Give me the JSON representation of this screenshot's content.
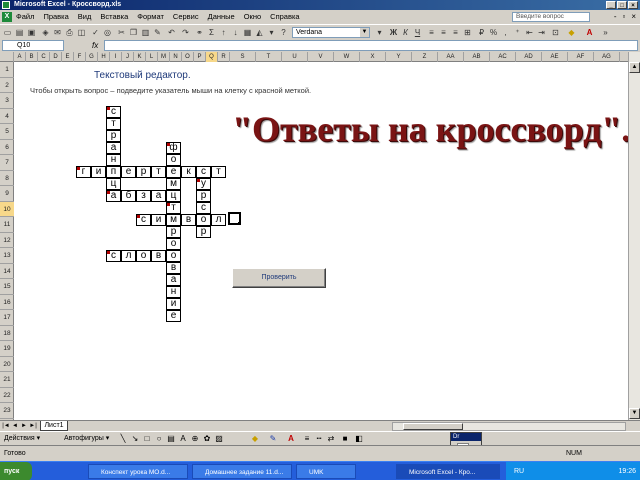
{
  "window": {
    "title": "Microsoft Excel - Кроссворд.xls",
    "buttons": [
      "_",
      "□",
      "×"
    ]
  },
  "menu": {
    "items": [
      "Файл",
      "Правка",
      "Вид",
      "Вставка",
      "Формат",
      "Сервис",
      "Данные",
      "Окно",
      "Справка"
    ],
    "help_placeholder": "Введите вопрос",
    "doc_controls": [
      "-",
      "▫",
      "×"
    ]
  },
  "toolbar": {
    "font_name": "Verdana",
    "icon_names": [
      "new-icon",
      "open-icon",
      "save-icon",
      "permission-icon",
      "email-icon",
      "print-icon",
      "preview-icon",
      "spelling-icon",
      "research-icon",
      "cut-icon",
      "copy-icon",
      "paste-icon",
      "format-painter-icon",
      "undo-icon",
      "redo-icon",
      "hyperlink-icon",
      "autosum-icon",
      "sort-asc-icon",
      "sort-desc-icon",
      "chart-wizard-icon",
      "drawing-icon",
      "zoom-icon",
      "help-icon"
    ]
  },
  "formula_bar": {
    "name_box": "Q10",
    "fx": "fx",
    "value": ""
  },
  "columns": [
    "A",
    "B",
    "C",
    "D",
    "E",
    "F",
    "G",
    "H",
    "I",
    "J",
    "K",
    "L",
    "M",
    "N",
    "O",
    "P",
    "Q",
    "R",
    "S",
    "T",
    "U",
    "V",
    "W",
    "X",
    "Y",
    "Z",
    "AA",
    "AB",
    "AC",
    "AD",
    "AE",
    "AF",
    "AG"
  ],
  "rows": [
    "1",
    "2",
    "3",
    "4",
    "5",
    "6",
    "7",
    "8",
    "9",
    "10",
    "11",
    "12",
    "13",
    "14",
    "15",
    "16",
    "17",
    "18",
    "19",
    "20",
    "21",
    "22",
    "23"
  ],
  "sheet": {
    "heading": "Текстовый редактор.",
    "instruction": "Чтобы открыть вопрос – подведите указатель мыши на клетку с красной меткой.",
    "answers_title": "\"Ответы на кроссворд\".",
    "check_button": "Проверить"
  },
  "crossword": {
    "cells": [
      {
        "r": 0,
        "c": 2,
        "ch": "с",
        "m": true
      },
      {
        "r": 1,
        "c": 2,
        "ch": "т"
      },
      {
        "r": 2,
        "c": 2,
        "ch": "р"
      },
      {
        "r": 3,
        "c": 2,
        "ch": "а"
      },
      {
        "r": 3,
        "c": 6,
        "ch": "ф",
        "m": true
      },
      {
        "r": 4,
        "c": 2,
        "ch": "н"
      },
      {
        "r": 4,
        "c": 6,
        "ch": "о"
      },
      {
        "r": 5,
        "c": 0,
        "ch": "г",
        "m": true
      },
      {
        "r": 5,
        "c": 1,
        "ch": "и"
      },
      {
        "r": 5,
        "c": 2,
        "ch": "п"
      },
      {
        "r": 5,
        "c": 3,
        "ch": "е"
      },
      {
        "r": 5,
        "c": 4,
        "ch": "р"
      },
      {
        "r": 5,
        "c": 5,
        "ch": "т"
      },
      {
        "r": 5,
        "c": 6,
        "ch": "е"
      },
      {
        "r": 5,
        "c": 7,
        "ch": "к"
      },
      {
        "r": 5,
        "c": 8,
        "ch": "с"
      },
      {
        "r": 5,
        "c": 9,
        "ch": "т"
      },
      {
        "r": 6,
        "c": 2,
        "ch": "ц"
      },
      {
        "r": 6,
        "c": 6,
        "ch": "м"
      },
      {
        "r": 6,
        "c": 8,
        "ch": "у",
        "m": true
      },
      {
        "r": 7,
        "c": 2,
        "ch": "а",
        "m": true
      },
      {
        "r": 7,
        "c": 3,
        "ch": "б"
      },
      {
        "r": 7,
        "c": 4,
        "ch": "з"
      },
      {
        "r": 7,
        "c": 5,
        "ch": "а"
      },
      {
        "r": 7,
        "c": 6,
        "ch": "ц"
      },
      {
        "r": 7,
        "c": 8,
        "ch": "р"
      },
      {
        "r": 8,
        "c": 6,
        "ch": "т",
        "m": true
      },
      {
        "r": 8,
        "c": 8,
        "ch": "с"
      },
      {
        "r": 9,
        "c": 4,
        "ch": "с",
        "m": true
      },
      {
        "r": 9,
        "c": 5,
        "ch": "и"
      },
      {
        "r": 9,
        "c": 6,
        "ch": "м"
      },
      {
        "r": 9,
        "c": 7,
        "ch": "в"
      },
      {
        "r": 9,
        "c": 8,
        "ch": "о"
      },
      {
        "r": 9,
        "c": 9,
        "ch": "л"
      },
      {
        "r": 10,
        "c": 6,
        "ch": "р"
      },
      {
        "r": 10,
        "c": 8,
        "ch": "р"
      },
      {
        "r": 11,
        "c": 6,
        "ch": "о"
      },
      {
        "r": 12,
        "c": 2,
        "ch": "с",
        "m": true
      },
      {
        "r": 12,
        "c": 3,
        "ch": "л"
      },
      {
        "r": 12,
        "c": 4,
        "ch": "о"
      },
      {
        "r": 12,
        "c": 5,
        "ch": "в"
      },
      {
        "r": 12,
        "c": 6,
        "ch": "о"
      },
      {
        "r": 13,
        "c": 6,
        "ch": "в"
      },
      {
        "r": 14,
        "c": 6,
        "ch": "а"
      },
      {
        "r": 15,
        "c": 6,
        "ch": "н"
      },
      {
        "r": 16,
        "c": 6,
        "ch": "и"
      },
      {
        "r": 17,
        "c": 6,
        "ch": "е"
      }
    ]
  },
  "sheet_tabs": {
    "nav": [
      "|◄",
      "◄",
      "►",
      "►|"
    ],
    "active": "Лист1"
  },
  "drawing_toolbar": {
    "draw_label": "Действия ▾",
    "autoshapes_label": "Автофигуры ▾",
    "icon_names": [
      "line-icon",
      "arrow-icon",
      "rectangle-icon",
      "oval-icon",
      "textbox-icon",
      "wordart-icon",
      "diagram-icon",
      "clipart-icon",
      "picture-icon",
      "fill-color-icon",
      "line-color-icon",
      "font-color-icon",
      "line-style-icon",
      "dash-style-icon",
      "arrow-style-icon",
      "shadow-icon",
      "3d-icon"
    ]
  },
  "mini_toolbar": {
    "title": "Dr",
    "button_icon": "picture-icon"
  },
  "status": {
    "ready": "Готово",
    "num": "NUM"
  },
  "taskbar": {
    "start": "пуск",
    "tasks": [
      {
        "label": "Конспект урока МО.d...",
        "active": false
      },
      {
        "label": "Домашнее задание 11.d...",
        "active": false
      },
      {
        "label": "UMK",
        "active": false
      },
      {
        "label": "Microsoft Excel - Кро...",
        "active": true
      }
    ],
    "lang": "RU",
    "clock": "19:26"
  },
  "colors": {
    "title_bar": "#0a246a",
    "answers_text": "#7a1414",
    "heading_text": "#1f3a7a",
    "marker": "#b00000",
    "taskbar": "#245edb"
  }
}
